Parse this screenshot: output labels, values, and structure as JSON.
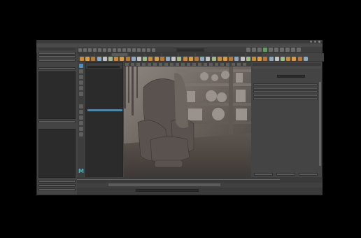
{
  "titlebar": {
    "title": ""
  },
  "menubar": {
    "items": [
      "",
      "",
      "",
      "",
      "",
      "",
      "",
      "",
      "",
      "",
      "",
      "",
      "",
      "",
      "",
      "",
      "",
      "",
      "",
      "",
      ""
    ]
  },
  "shelf": {
    "tabs": [
      "",
      "",
      "",
      "",
      "",
      "",
      "",
      "",
      "",
      "",
      ""
    ],
    "active_tab": 2
  },
  "outliner": {
    "rows": [
      "",
      "",
      "",
      "",
      "",
      "",
      "",
      "",
      "",
      "",
      "",
      "",
      "",
      "",
      ""
    ],
    "selected_index": 14
  },
  "colors": {
    "accent": "#5285a6",
    "viewport_bg": "#6e6560",
    "panel": "#444444"
  }
}
